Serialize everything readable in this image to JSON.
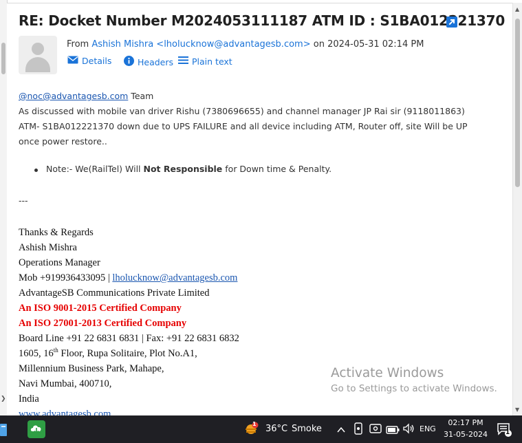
{
  "email": {
    "subject": "RE: Docket Number M2024053111187 ATM ID : S1BA012221370",
    "from_prefix": "From",
    "sender": "Ashish Mishra <lholucknow@advantagesb.com>",
    "date_text": "on 2024-05-31 02:14 PM",
    "actions": {
      "details": "Details",
      "headers": "Headers",
      "plain_text": "Plain text"
    },
    "body": {
      "mention": "@noc@advantagesb.com",
      "mention_suffix": " Team",
      "paragraph": "As discussed with mobile van driver Rishu (7380696655) and channel manager JP Rai sir (9118011863) ATM- S1BA012221370 down due to UPS FAILURE and all device including ATM, Router off, site Will be UP once power restore..",
      "note_prefix": "Note:- We(RailTel) Will ",
      "note_bold": "Not Responsible",
      "note_suffix": " for Down time & Penalty.",
      "separator": "---"
    },
    "signature": {
      "regards": "Thanks & Regards",
      "name": "Ashish Mishra",
      "title": "Operations Manager",
      "mob_prefix": "Mob +919936433095 | ",
      "mob_email": "lholucknow@advantagesb.com",
      "company": "AdvantageSB Communications Private Limited",
      "iso1": "An ISO 9001-2015 Certified Company",
      "iso2": "An ISO 27001-2013 Certified Company",
      "board": "Board Line +91 22 6831 6831 | Fax: +91 22 6831 6832",
      "addr1_a": "1605, 16",
      "addr1_sup": "th",
      "addr1_b": " Floor, Rupa Solitaire, Plot No.A1,",
      "addr2": "Millennium Business Park, Mahape,",
      "addr3": "Navi Mumbai, 400710,",
      "country": "India",
      "website": "www.advantagesb.com"
    }
  },
  "watermark": {
    "title": "Activate Windows",
    "subtitle": "Go to Settings to activate Windows."
  },
  "taskbar": {
    "weather_temp": "36°C",
    "weather_cond": "Smoke",
    "weather_badge": "1",
    "language": "ENG",
    "time": "02:17 PM",
    "date": "31-05-2024",
    "notification_count": "1"
  },
  "colors": {
    "link": "#1a73d8",
    "iso_red": "#e60000",
    "taskbar_bg": "#1f1f24",
    "subject_text": "#202020"
  },
  "icons": [
    "external-link-icon",
    "avatar-placeholder-icon",
    "mail-icon",
    "info-icon",
    "list-icon",
    "chevron-up-icon",
    "video-icon",
    "battery-icon",
    "wifi-icon",
    "speaker-icon",
    "notification-icon",
    "weather-icon",
    "app-icon"
  ]
}
